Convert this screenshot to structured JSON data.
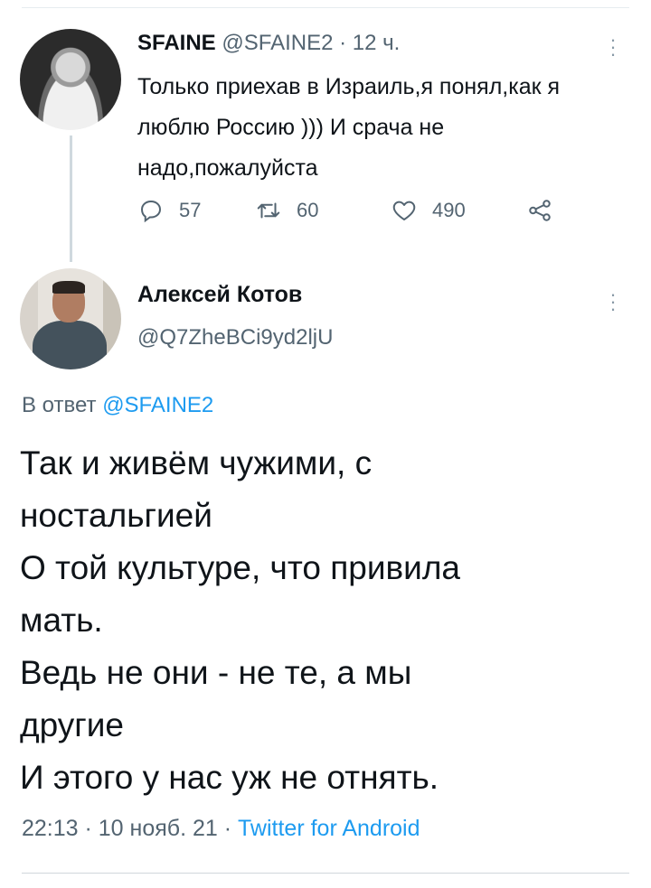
{
  "tweet1": {
    "display_name": "SFAINE",
    "handle": "@SFAINE2",
    "separator": "·",
    "time": "12 ч.",
    "text": "Только приехав в Израиль,я понял,как я люблю Россию ))) И срача не надо,пожалуйста",
    "actions": {
      "replies": "57",
      "retweets": "60",
      "likes": "490"
    }
  },
  "tweet2": {
    "display_name": "Алексей Котов",
    "handle": "@Q7ZheBCi9yd2ljU",
    "reply_prefix": "В ответ",
    "reply_mention": "@SFAINE2",
    "lines": [
      "Так и живём чужими, с",
      "ностальгией",
      "О той культуре, что привила",
      "мать.",
      "Ведь не они - не те, а мы",
      "другие",
      "И этого у нас уж не отнять."
    ],
    "footer_time": "22:13 · 10 нояб. 21 ·",
    "footer_app": "Twitter for Android"
  },
  "icons": {
    "reply": "reply-icon",
    "retweet": "retweet-icon",
    "like": "heart-icon",
    "share": "share-icon",
    "more": "more-vertical-icon"
  },
  "colors": {
    "link": "#1d9bf0",
    "secondary": "#536471",
    "text": "#0f1419"
  }
}
